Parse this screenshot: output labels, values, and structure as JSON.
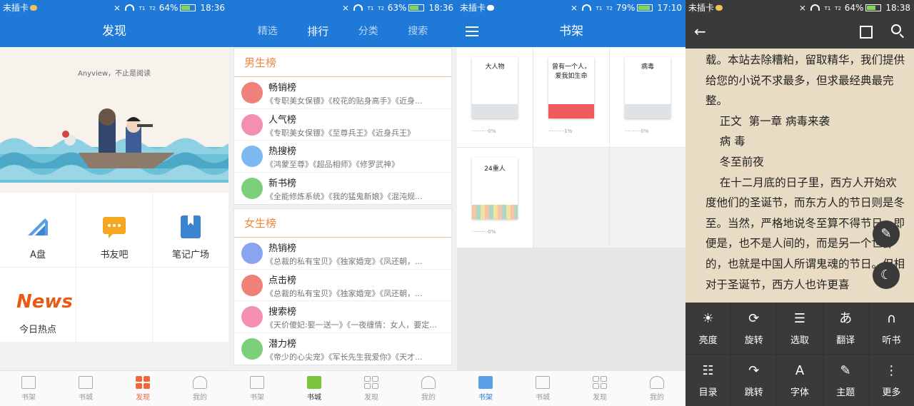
{
  "colors": {
    "primary": "#1e79d7",
    "reader_bg": "#e8dcc4",
    "accent_orange": "#f0883b"
  },
  "p1": {
    "status": {
      "carrier": "未插卡",
      "sim1": "T1",
      "sim2": "T2",
      "battery": "64%",
      "time": "18:36"
    },
    "title": "发现",
    "banner_slogan": "Anyview，不止是阅读",
    "grid": [
      {
        "label": "A盘",
        "icon": "a-disk-icon"
      },
      {
        "label": "书友吧",
        "icon": "chat-bubble-icon"
      },
      {
        "label": "笔记广场",
        "icon": "bookmark-note-icon"
      },
      {
        "label": "今日热点",
        "icon": "news-icon",
        "logo_text": "News"
      }
    ],
    "nav": [
      "书架",
      "书城",
      "发现",
      "我的"
    ]
  },
  "p2": {
    "status": {
      "battery": "63%",
      "time": "18:36",
      "sim1": "T1",
      "sim2": "T2"
    },
    "tabs": [
      "精选",
      "排行",
      "分类",
      "搜索"
    ],
    "male": {
      "title": "男生榜",
      "rows": [
        {
          "name": "畅销榜",
          "desc": "《专职美女保镖》《校花的贴身高手》《近身..."
        },
        {
          "name": "人气榜",
          "desc": "《专职美女保镖》《至尊兵王》《近身兵王》"
        },
        {
          "name": "热搜榜",
          "desc": "《鸿蒙至尊》《超品相师》《修罗武神》"
        },
        {
          "name": "新书榜",
          "desc": "《全能修炼系统》《我的猛鬼新娘》《混沌规..."
        }
      ]
    },
    "female": {
      "title": "女生榜",
      "rows": [
        {
          "name": "热销榜",
          "desc": "《总裁的私有宝贝》《独家婚宠》《凤还朝，..."
        },
        {
          "name": "点击榜",
          "desc": "《总裁的私有宝贝》《独家婚宠》《凤还朝，..."
        },
        {
          "name": "搜索榜",
          "desc": "《天价傻妃:娶一送一》《一夜缠情：女人，要定..."
        },
        {
          "name": "潜力榜",
          "desc": "《帝少的心尖宠》《军长先生我爱你》《天才..."
        }
      ]
    },
    "nav": [
      "书架",
      "书城",
      "发现",
      "我的"
    ]
  },
  "p3": {
    "status": {
      "carrier": "未插卡",
      "battery": "79%",
      "time": "17:10",
      "sim1": "T1",
      "sim2": "T2"
    },
    "title": "书架",
    "books": [
      {
        "title": "大人物",
        "progress": "··········0%"
      },
      {
        "title": "曾有一个人，爱我如生命",
        "progress": "··········1%"
      },
      {
        "title": "病毒",
        "progress": "··········0%"
      },
      {
        "title": "24重人",
        "progress": "··········0%"
      }
    ],
    "nav": [
      "书架",
      "书城",
      "发现",
      "我的"
    ]
  },
  "p4": {
    "status": {
      "carrier": "未插卡",
      "battery": "64%",
      "time": "18:38",
      "sim1": "T1",
      "sim2": "T2"
    },
    "paragraphs": [
      "载。本站去除糟粕，留取精华，我们提供给您的小说不求最多，但求最经典最完整。",
      "    正文  第一章 病毒来袭",
      "    病 毒",
      "    冬至前夜",
      "    在十二月底的日子里，西方人开始欢度他们的圣诞节，而东方人的节日则是冬至。当然，严格地说冬至算不得节日，即便是，也不是人间的，而是另一个世界的，也就是中国人所谓鬼魂的节日。但相对于圣诞节，西方人也许更喜"
    ],
    "menu": [
      {
        "label": "亮度",
        "icon": "brightness-icon",
        "glyph": "☀"
      },
      {
        "label": "旋转",
        "icon": "rotate-icon",
        "glyph": "⟳"
      },
      {
        "label": "选取",
        "icon": "select-text-icon",
        "glyph": "☰"
      },
      {
        "label": "翻译",
        "icon": "translate-icon",
        "glyph": "あ"
      },
      {
        "label": "听书",
        "icon": "headphones-icon",
        "glyph": "🎧"
      },
      {
        "label": "目录",
        "icon": "list-icon",
        "glyph": "☷"
      },
      {
        "label": "跳转",
        "icon": "jump-icon",
        "glyph": "↷"
      },
      {
        "label": "字体",
        "icon": "font-icon",
        "glyph": "A"
      },
      {
        "label": "主题",
        "icon": "brush-icon",
        "glyph": "✎"
      },
      {
        "label": "更多",
        "icon": "more-icon",
        "glyph": "⋮"
      }
    ]
  }
}
